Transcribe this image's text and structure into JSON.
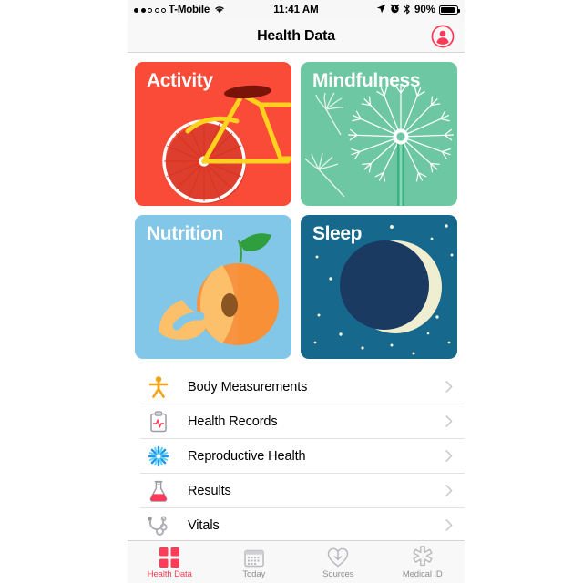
{
  "status_bar": {
    "signal_dots_filled": 2,
    "signal_dots_total": 5,
    "carrier": "T-Mobile",
    "wifi_icon": "wifi-icon",
    "time": "11:41 AM",
    "location_icon": "location-arrow-icon",
    "alarm_icon": "alarm-clock-icon",
    "bluetooth_icon": "bluetooth-icon",
    "battery_percent": "90%",
    "battery_level": 90
  },
  "nav": {
    "title": "Health Data",
    "profile_icon": "profile-person-circle-icon",
    "profile_color": "#fb3a58"
  },
  "tiles": [
    {
      "label": "Activity",
      "bg": "#fa4b38",
      "art": "bicycle",
      "name": "tile-activity"
    },
    {
      "label": "Mindfulness",
      "bg": "#6ec7a3",
      "art": "dandelion",
      "name": "tile-mindfulness"
    },
    {
      "label": "Nutrition",
      "bg": "#83c7e8",
      "art": "peach",
      "name": "tile-nutrition"
    },
    {
      "label": "Sleep",
      "bg": "#16688d",
      "art": "moon",
      "name": "tile-sleep"
    }
  ],
  "list": {
    "items": [
      {
        "label": "Body Measurements",
        "icon": "body-figure-icon",
        "chevron": "chevron-right-icon"
      },
      {
        "label": "Health Records",
        "icon": "clipboard-ekg-icon",
        "chevron": "chevron-right-icon"
      },
      {
        "label": "Reproductive Health",
        "icon": "snowflake-burst-icon",
        "chevron": "chevron-right-icon"
      },
      {
        "label": "Results",
        "icon": "flask-icon",
        "chevron": "chevron-right-icon"
      },
      {
        "label": "Vitals",
        "icon": "stethoscope-icon",
        "chevron": "chevron-right-icon"
      }
    ]
  },
  "tabbar": {
    "active_color": "#fc3d5a",
    "inactive_color": "#8e8e93",
    "tabs": [
      {
        "label": "Health Data",
        "icon": "four-squares-icon",
        "active": true
      },
      {
        "label": "Today",
        "icon": "calendar-icon",
        "active": false
      },
      {
        "label": "Sources",
        "icon": "heart-download-icon",
        "active": false
      },
      {
        "label": "Medical ID",
        "icon": "medical-asterisk-icon",
        "active": false
      }
    ]
  }
}
